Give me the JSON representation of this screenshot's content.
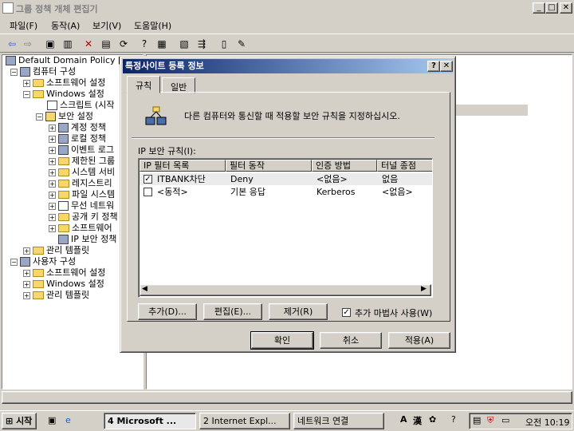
{
  "window": {
    "title": "그룹 정책 개체 편집기"
  },
  "menu": [
    "파일(F)",
    "동작(A)",
    "보기(V)",
    "도움말(H)"
  ],
  "tree": {
    "root": "Default Domain Policy [I",
    "computer_config": "컴퓨터 구성",
    "software_settings": "소프트웨어 설정",
    "windows_settings": "Windows 설정",
    "scripts": "스크립트 (시작",
    "security_settings": "보안 설정",
    "security_children": [
      "계정 정책",
      "로컬 정책",
      "이벤트 로그",
      "제한된 그룹",
      "시스템 서비",
      "레지스트리",
      "파일 시스템",
      "무선 네트워",
      "공개 키 정책",
      "소프트웨어",
      "IP 보안 정책"
    ],
    "admin_templates": "관리 템플릿",
    "user_config": "사용자 구성",
    "user_children": [
      "소프트웨어 설정",
      "Windows 설정",
      "관리 템플릿"
    ]
  },
  "dialog": {
    "title": "특정사이트 등록 정보",
    "help_glyph": "?",
    "close_glyph": "✕",
    "tabs": [
      "규칙",
      "일반"
    ],
    "description": "다른 컴퓨터와 통신할 때 적용할 보안 규칙을 지정하십시오.",
    "rules_label": "IP 보안 규칙(I):",
    "columns": [
      "IP 필터 목록",
      "필터 동작",
      "인증 방법",
      "터널 종점"
    ],
    "rows": [
      {
        "checked": true,
        "filter": "ITBANK차단",
        "action": "Deny",
        "auth": "<없음>",
        "tunnel": "없음"
      },
      {
        "checked": false,
        "filter": "<동적>",
        "action": "기본 응답",
        "auth": "Kerberos",
        "tunnel": "<없음>"
      }
    ],
    "add_button": "추가(D)...",
    "edit_button": "편집(E)...",
    "remove_button": "제거(R)",
    "wizard_checkbox": "추가 마법사 사용(W)",
    "wizard_checked": true,
    "ok": "확인",
    "cancel": "취소",
    "apply": "적용(A)"
  },
  "taskbar": {
    "start": "시작",
    "tasks": [
      "4 Microsoft ...",
      "2 Internet Expl...",
      "네트워크 연결"
    ],
    "clock": "오전 10:19"
  }
}
